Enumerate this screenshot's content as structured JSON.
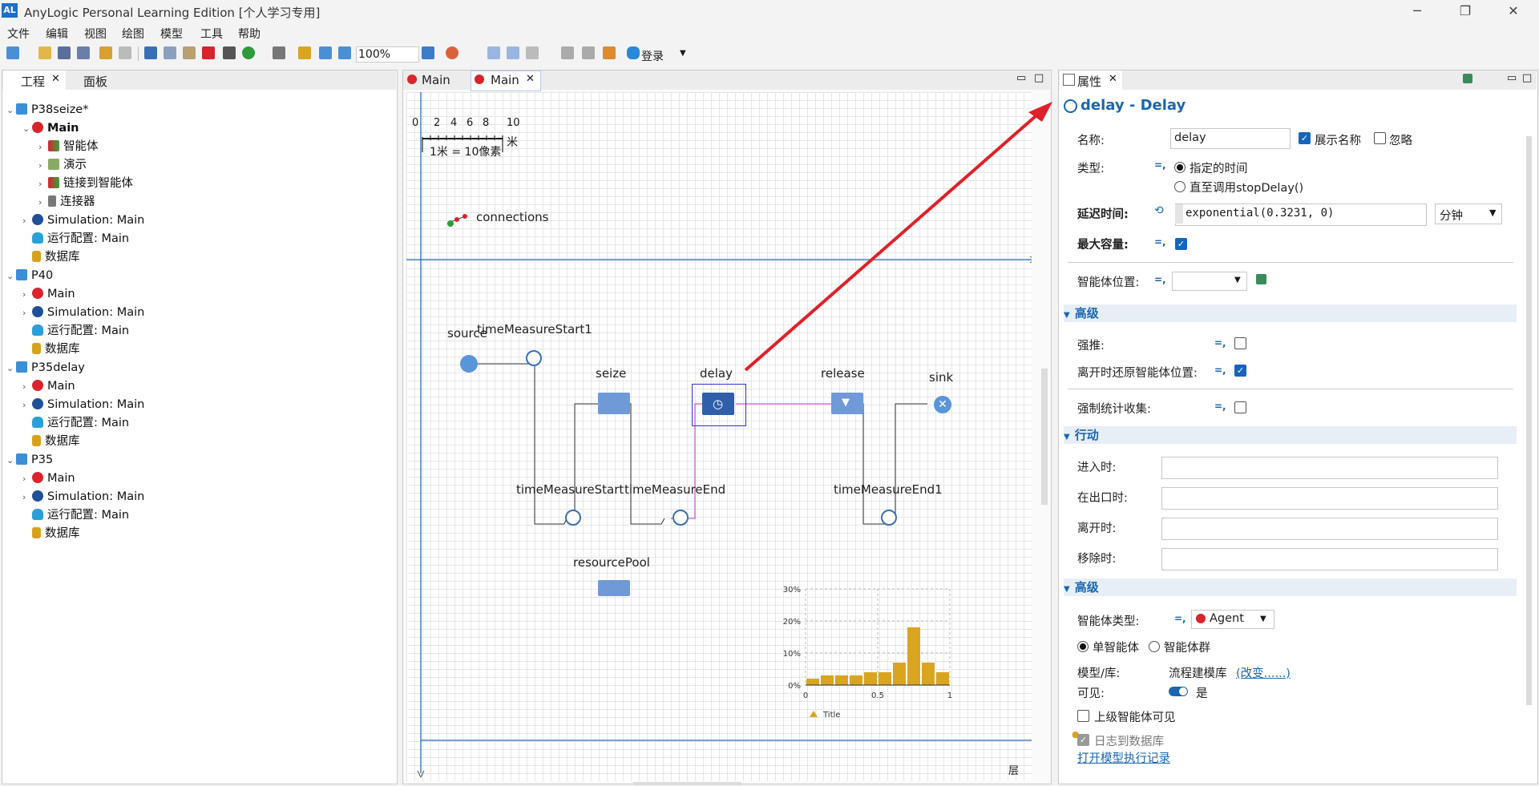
{
  "window": {
    "title": "AnyLogic Personal Learning Edition [个人学习专用]",
    "logo": "AL",
    "controls": [
      "─",
      "❐",
      "✕"
    ]
  },
  "menu": [
    "文件",
    "编辑",
    "视图",
    "绘图",
    "模型",
    "工具",
    "帮助"
  ],
  "toolbar": {
    "zoom": "100%",
    "login": "登录"
  },
  "left_panel": {
    "tabs": [
      "工程",
      "面板"
    ],
    "tree": [
      {
        "text": "P38seize*",
        "icon": "proj"
      },
      {
        "text": "Main",
        "icon": "red"
      },
      {
        "text": "智能体",
        "icon": "mix"
      },
      {
        "text": "演示",
        "icon": "present"
      },
      {
        "text": "链接到智能体",
        "icon": "mix"
      },
      {
        "text": "连接器",
        "icon": "conn"
      },
      {
        "text": "Simulation: Main",
        "icon": "blue"
      },
      {
        "text": "运行配置: Main",
        "icon": "cloud"
      },
      {
        "text": "数据库",
        "icon": "db"
      },
      {
        "text": "P40",
        "icon": "proj"
      },
      {
        "text": "Main",
        "icon": "red"
      },
      {
        "text": "Simulation: Main",
        "icon": "blue"
      },
      {
        "text": "运行配置: Main",
        "icon": "cloud"
      },
      {
        "text": "数据库",
        "icon": "db"
      },
      {
        "text": "P35delay",
        "icon": "proj"
      },
      {
        "text": "Main",
        "icon": "red"
      },
      {
        "text": "Simulation: Main",
        "icon": "blue"
      },
      {
        "text": "运行配置: Main",
        "icon": "cloud"
      },
      {
        "text": "数据库",
        "icon": "db"
      },
      {
        "text": "P35",
        "icon": "proj"
      },
      {
        "text": "Main",
        "icon": "red"
      },
      {
        "text": "Simulation: Main",
        "icon": "blue"
      },
      {
        "text": "运行配置: Main",
        "icon": "cloud"
      },
      {
        "text": "数据库",
        "icon": "db"
      }
    ]
  },
  "editor": {
    "tabs": [
      "Main",
      "Main"
    ],
    "scale": {
      "ticks": [
        "0",
        "2",
        "4",
        "6",
        "8",
        "10"
      ],
      "unit": "米",
      "caption": "1米 = 10像素"
    },
    "connections_label": "connections",
    "blocks": {
      "source": "source",
      "tms1": "timeMeasureStart1",
      "seize": "seize",
      "delay": "delay",
      "release": "release",
      "sink": "sink",
      "tms": "timeMeasureStart",
      "tme": "timeMeasureEnd",
      "tme1": "timeMeasureEnd1",
      "pool": "resourcePool"
    },
    "layers_label": "层"
  },
  "chart_data": {
    "type": "bar",
    "title": "Title",
    "x_ticks": [
      "0",
      "0.5",
      "1"
    ],
    "y_ticks": [
      "0%",
      "10%",
      "20%",
      "30%"
    ],
    "xlim": [
      0,
      1
    ],
    "ylim": [
      0,
      30
    ],
    "values": [
      2,
      3,
      3,
      3,
      4,
      4,
      7,
      18,
      7,
      4
    ],
    "color": "#d9a520"
  },
  "properties": {
    "tab": "属性",
    "header": "delay - Delay",
    "name_label": "名称:",
    "name_value": "delay",
    "show_name": "展示名称",
    "ignore": "忽略",
    "type_label": "类型:",
    "type_opt1": "指定的时间",
    "type_opt2": "直至调用stopDelay()",
    "delay_label": "延迟时间:",
    "delay_value": "exponential(0.3231, 0)",
    "delay_unit": "分钟",
    "capacity_label": "最大容量:",
    "agent_loc_label": "智能体位置:",
    "sec_advanced": "高级",
    "force_push": "强推:",
    "restore_loc": "离开时还原智能体位置:",
    "force_stats": "强制统计收集:",
    "sec_actions": "行动",
    "on_enter": "进入时:",
    "on_at_exit": "在出口时:",
    "on_exit": "离开时:",
    "on_remove": "移除时:",
    "sec_advanced2": "高级",
    "agent_type_label": "智能体类型:",
    "agent_type_value": "Agent",
    "single_agent": "单智能体",
    "agent_pop": "智能体群",
    "model_lib_label": "模型/库:",
    "model_lib_value": "流程建模库",
    "change_link": "(改变......)",
    "visible_label": "可见:",
    "visible_value": "是",
    "upper_visible": "上级智能体可见",
    "log_db": "日志到数据库",
    "open_log": "打开模型执行记录"
  },
  "colors": {
    "accent": "#1565c0",
    "arrow": "#e0202a",
    "block": "#6f9ad7"
  }
}
